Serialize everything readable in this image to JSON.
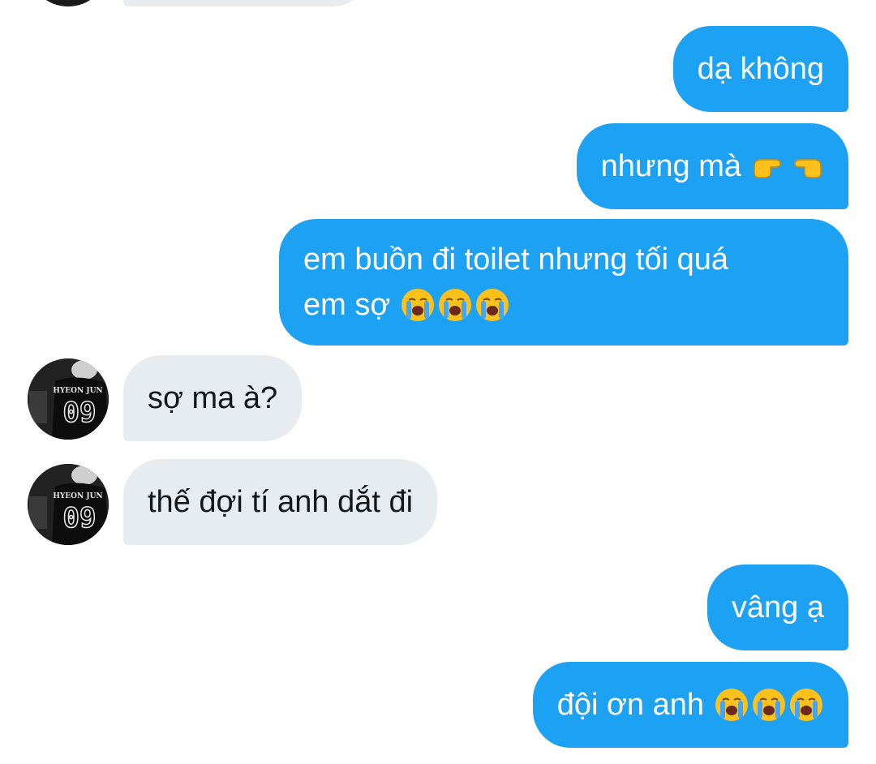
{
  "messages": [
    {
      "side": "sent",
      "text": "dạ không",
      "emoji": ""
    },
    {
      "side": "sent",
      "text": "nhưng mà",
      "emoji": "pointing-hands"
    },
    {
      "side": "sent",
      "line1": "em buồn đi toilet nhưng tối quá",
      "line2": "em sợ",
      "emoji": "crying-faces"
    },
    {
      "side": "received",
      "text": "sợ ma à?"
    },
    {
      "side": "received",
      "text": "thế đợi tí anh dắt đi"
    },
    {
      "side": "sent",
      "text": "vâng ạ",
      "emoji": ""
    },
    {
      "side": "sent",
      "text": "đội ơn anh",
      "emoji": "crying-faces"
    }
  ],
  "avatar": {
    "shirt_name": "HYEON JUN",
    "shirt_number": "09"
  },
  "colors": {
    "sent_bubble": "#1da1f2",
    "received_bubble": "#e6ecf0",
    "received_text": "#14171a"
  }
}
